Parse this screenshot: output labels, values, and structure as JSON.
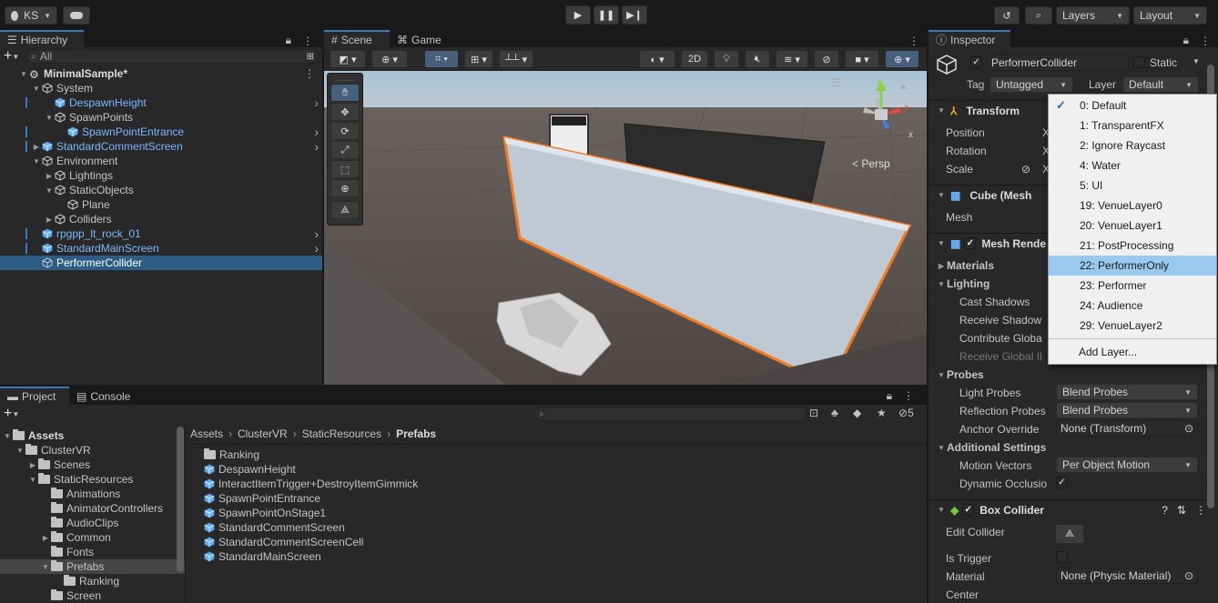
{
  "toolbar": {
    "account": "KS",
    "layers": "Layers",
    "layout": "Layout"
  },
  "hierarchy": {
    "tab": "Hierarchy",
    "search_placeholder": "All",
    "items": [
      {
        "label": "MinimalSample*",
        "depth": 0,
        "type": "scene"
      },
      {
        "label": "System",
        "depth": 1,
        "type": "obj"
      },
      {
        "label": "DespawnHeight",
        "depth": 2,
        "type": "prefab"
      },
      {
        "label": "SpawnPoints",
        "depth": 2,
        "type": "obj"
      },
      {
        "label": "SpawnPointEntrance",
        "depth": 3,
        "type": "prefab"
      },
      {
        "label": "StandardCommentScreen",
        "depth": 1,
        "type": "prefab"
      },
      {
        "label": "Environment",
        "depth": 1,
        "type": "obj"
      },
      {
        "label": "Lightings",
        "depth": 2,
        "type": "obj"
      },
      {
        "label": "StaticObjects",
        "depth": 2,
        "type": "obj"
      },
      {
        "label": "Plane",
        "depth": 3,
        "type": "obj"
      },
      {
        "label": "Colliders",
        "depth": 2,
        "type": "obj"
      },
      {
        "label": "rpgpp_lt_rock_01",
        "depth": 1,
        "type": "prefab"
      },
      {
        "label": "StandardMainScreen",
        "depth": 1,
        "type": "prefab"
      },
      {
        "label": "PerformerCollider",
        "depth": 1,
        "type": "selected"
      }
    ]
  },
  "scene": {
    "tab_scene": "Scene",
    "tab_game": "Game",
    "btn_2d": "2D",
    "persp": "Persp",
    "axis_x": "x",
    "axis_y": "y",
    "axis_z": "z"
  },
  "project": {
    "tab_project": "Project",
    "tab_console": "Console",
    "hidden_count": "5",
    "breadcrumb": [
      "Assets",
      "ClusterVR",
      "StaticResources",
      "Prefabs"
    ],
    "tree": [
      {
        "label": "Assets",
        "depth": 0,
        "bold": true
      },
      {
        "label": "ClusterVR",
        "depth": 1
      },
      {
        "label": "Scenes",
        "depth": 2
      },
      {
        "label": "StaticResources",
        "depth": 2
      },
      {
        "label": "Animations",
        "depth": 3
      },
      {
        "label": "AnimatorControllers",
        "depth": 3
      },
      {
        "label": "AudioClips",
        "depth": 3
      },
      {
        "label": "Common",
        "depth": 3
      },
      {
        "label": "Fonts",
        "depth": 3
      },
      {
        "label": "Prefabs",
        "depth": 3,
        "selected": true
      },
      {
        "label": "Ranking",
        "depth": 4
      },
      {
        "label": "Screen",
        "depth": 3
      }
    ],
    "files": [
      {
        "label": "Ranking",
        "type": "folder"
      },
      {
        "label": "DespawnHeight",
        "type": "prefab"
      },
      {
        "label": "InteractItemTrigger+DestroyItemGimmick",
        "type": "prefab"
      },
      {
        "label": "SpawnPointEntrance",
        "type": "prefab"
      },
      {
        "label": "SpawnPointOnStage1",
        "type": "prefab"
      },
      {
        "label": "StandardCommentScreen",
        "type": "prefab"
      },
      {
        "label": "StandardCommentScreenCell",
        "type": "prefab"
      },
      {
        "label": "StandardMainScreen",
        "type": "prefab"
      }
    ]
  },
  "inspector": {
    "tab": "Inspector",
    "object_name": "PerformerCollider",
    "static_label": "Static",
    "tag_label": "Tag",
    "tag_value": "Untagged",
    "layer_label": "Layer",
    "layer_value": "Default",
    "transform": "Transform",
    "position": "Position",
    "rotation": "Rotation",
    "scale": "Scale",
    "x_short": "X",
    "cube_mesh": "Cube (Mesh",
    "mesh": "Mesh",
    "mesh_renderer": "Mesh Rende",
    "materials": "Materials",
    "lighting": "Lighting",
    "cast_shadows": "Cast Shadows",
    "receive_shadows": "Receive Shadow",
    "contribute_global": "Contribute Globa",
    "receive_global": "Receive Global Il",
    "probes": "Probes",
    "light_probes": "Light Probes",
    "light_probes_val": "Blend Probes",
    "reflection_probes": "Reflection Probes",
    "reflection_probes_val": "Blend Probes",
    "anchor_override": "Anchor Override",
    "anchor_override_val": "None (Transform)",
    "additional": "Additional Settings",
    "motion_vectors": "Motion Vectors",
    "motion_vectors_val": "Per Object Motion",
    "dynamic_occlusion": "Dynamic Occlusio",
    "box_collider": "Box Collider",
    "edit_collider": "Edit Collider",
    "is_trigger": "Is Trigger",
    "material": "Material",
    "material_val": "None (Physic Material)",
    "center": "Center"
  },
  "layer_popup": {
    "items": [
      "0: Default",
      "1: TransparentFX",
      "2: Ignore Raycast",
      "4: Water",
      "5: UI",
      "19: VenueLayer0",
      "20: VenueLayer1",
      "21: PostProcessing",
      "22: PerformerOnly",
      "23: Performer",
      "24: Audience",
      "29: VenueLayer2"
    ],
    "checked": 0,
    "highlighted": 8,
    "add_layer": "Add Layer..."
  },
  "colors": {
    "accent": "#3a79bb",
    "prefab_text": "#7cb8ff",
    "selection": "#2c5d87",
    "highlight_outline": "#f47a1f"
  }
}
